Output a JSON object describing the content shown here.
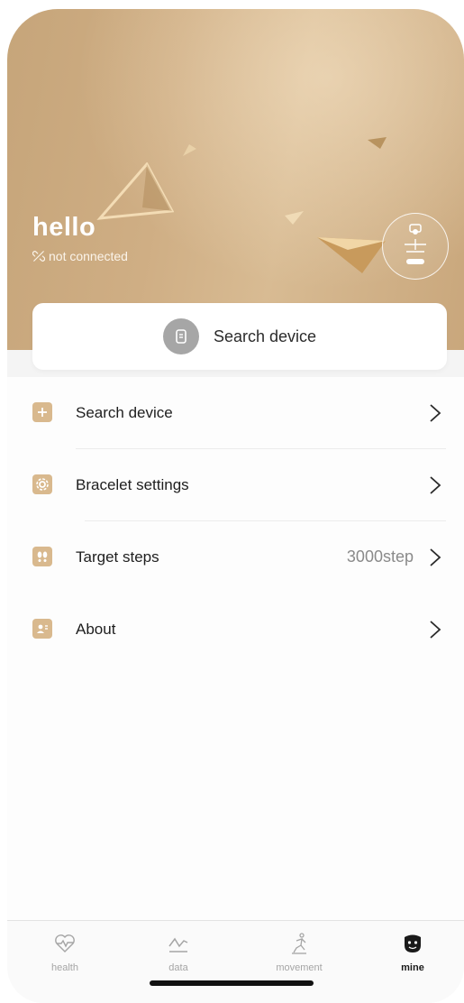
{
  "header": {
    "greeting": "hello",
    "connection_status": "not connected",
    "connection_icon": "link-broken-icon",
    "device_badge_icon": "watch-icon"
  },
  "search_card": {
    "label": "Search device",
    "icon": "watch-icon"
  },
  "menu": {
    "items": [
      {
        "label": "Search device",
        "icon": "plus-icon",
        "value": ""
      },
      {
        "label": "Bracelet settings",
        "icon": "gear-icon",
        "value": ""
      },
      {
        "label": "Target steps",
        "icon": "footprints-icon",
        "value": "3000step"
      },
      {
        "label": "About",
        "icon": "contact-card-icon",
        "value": ""
      }
    ]
  },
  "tabbar": {
    "tabs": [
      {
        "label": "health",
        "icon": "heart-pulse-icon",
        "active": false
      },
      {
        "label": "data",
        "icon": "chart-line-icon",
        "active": false
      },
      {
        "label": "movement",
        "icon": "running-icon",
        "active": false
      },
      {
        "label": "mine",
        "icon": "face-icon",
        "active": true
      }
    ]
  },
  "colors": {
    "accent": "#d9b98e",
    "hero_gradient_start": "#c6a57a",
    "hero_gradient_end": "#d8bb93",
    "active_tab": "#1a1a1a",
    "inactive_tab": "#a5a5a5"
  }
}
